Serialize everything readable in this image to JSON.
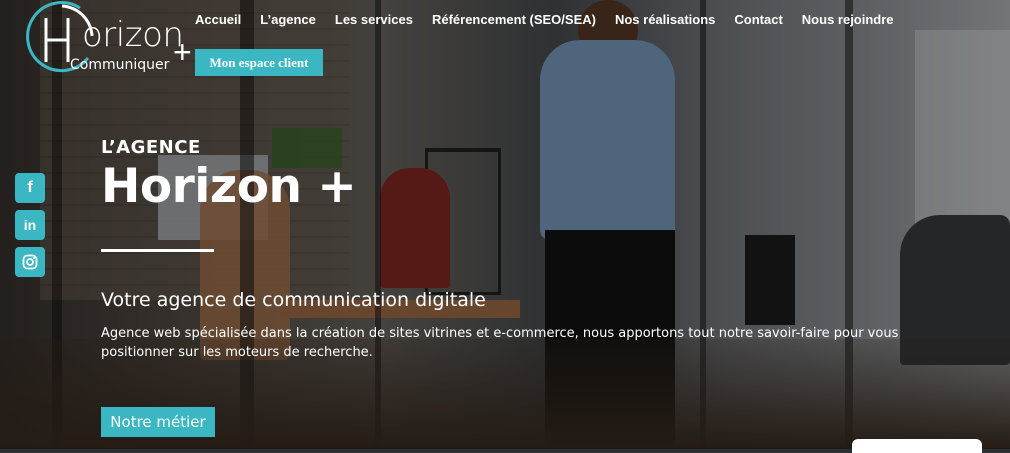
{
  "brand": {
    "name": "orizon",
    "initial": "H",
    "tagline": "Communiquer",
    "plus": "+"
  },
  "nav": {
    "items": [
      {
        "label": "Accueil"
      },
      {
        "label": "L’agence"
      },
      {
        "label": "Les services"
      },
      {
        "label": "Référencement (SEO/SEA)"
      },
      {
        "label": "Nos réalisations"
      },
      {
        "label": "Contact"
      },
      {
        "label": "Nous rejoindre"
      }
    ],
    "client_button": "Mon espace client"
  },
  "social": {
    "items": [
      {
        "name": "facebook-icon",
        "glyph": "f"
      },
      {
        "name": "linkedin-icon",
        "glyph": "in"
      },
      {
        "name": "instagram-icon",
        "glyph": ""
      }
    ]
  },
  "hero": {
    "eyebrow": "L’AGENCE",
    "title": "Horizon +",
    "subtitle": "Votre agence de communication digitale",
    "description": "Agence web spécialisée dans la création de sites vitrines et e-commerce, nous apportons tout notre savoir-faire pour vous positionner sur les moteurs de recherche.",
    "cta": "Notre métier"
  },
  "colors": {
    "accent": "#3bb7c4",
    "text": "#ffffff"
  }
}
